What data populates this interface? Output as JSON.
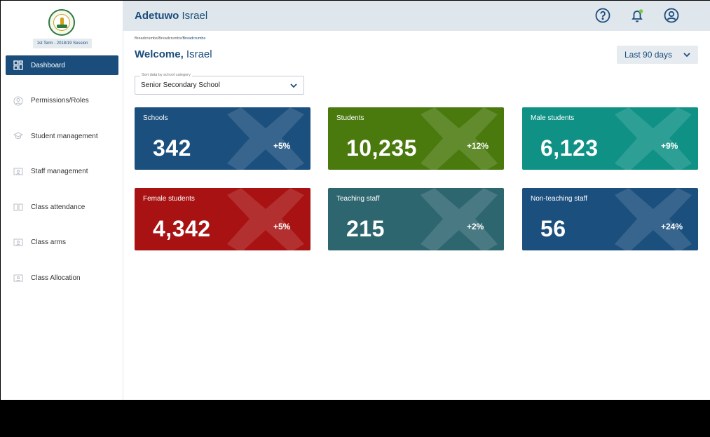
{
  "sidebar": {
    "session": "1st Term - 2018/19 Session",
    "items": [
      {
        "label": "Dashboard"
      },
      {
        "label": "Permissions/Roles"
      },
      {
        "label": "Student management"
      },
      {
        "label": "Staff management"
      },
      {
        "label": "Class attendance"
      },
      {
        "label": "Class arms"
      },
      {
        "label": "Class Allocation"
      }
    ]
  },
  "header": {
    "first_name": "Adetuwo",
    "last_name": "Israel",
    "icons": [
      "help-icon",
      "bell-icon",
      "user-icon"
    ]
  },
  "breadcrumb": {
    "part1": "Breadcrumbs/",
    "part2": "Breadcrumbs/",
    "part3": "Breadcrumbs"
  },
  "welcome": {
    "greeting": "Welcome,",
    "name": "Israel"
  },
  "range": {
    "selected": "Last 90 days"
  },
  "filter": {
    "label": "Sort data by school category",
    "selected": "Senior Secondary School"
  },
  "cards": [
    {
      "label": "Schools",
      "value": "342",
      "delta": "+5%",
      "color": "#1b4f7d"
    },
    {
      "label": "Students",
      "value": "10,235",
      "delta": "+12%",
      "color": "#4a7a0e"
    },
    {
      "label": "Male students",
      "value": "6,123",
      "delta": "+9%",
      "color": "#0f9185"
    },
    {
      "label": "Female students",
      "value": "4,342",
      "delta": "+5%",
      "color": "#a81212"
    },
    {
      "label": "Teaching staff",
      "value": "215",
      "delta": "+2%",
      "color": "#2e6670"
    },
    {
      "label": "Non-teaching staff",
      "value": "56",
      "delta": "+24%",
      "color": "#1b4f7d"
    }
  ]
}
